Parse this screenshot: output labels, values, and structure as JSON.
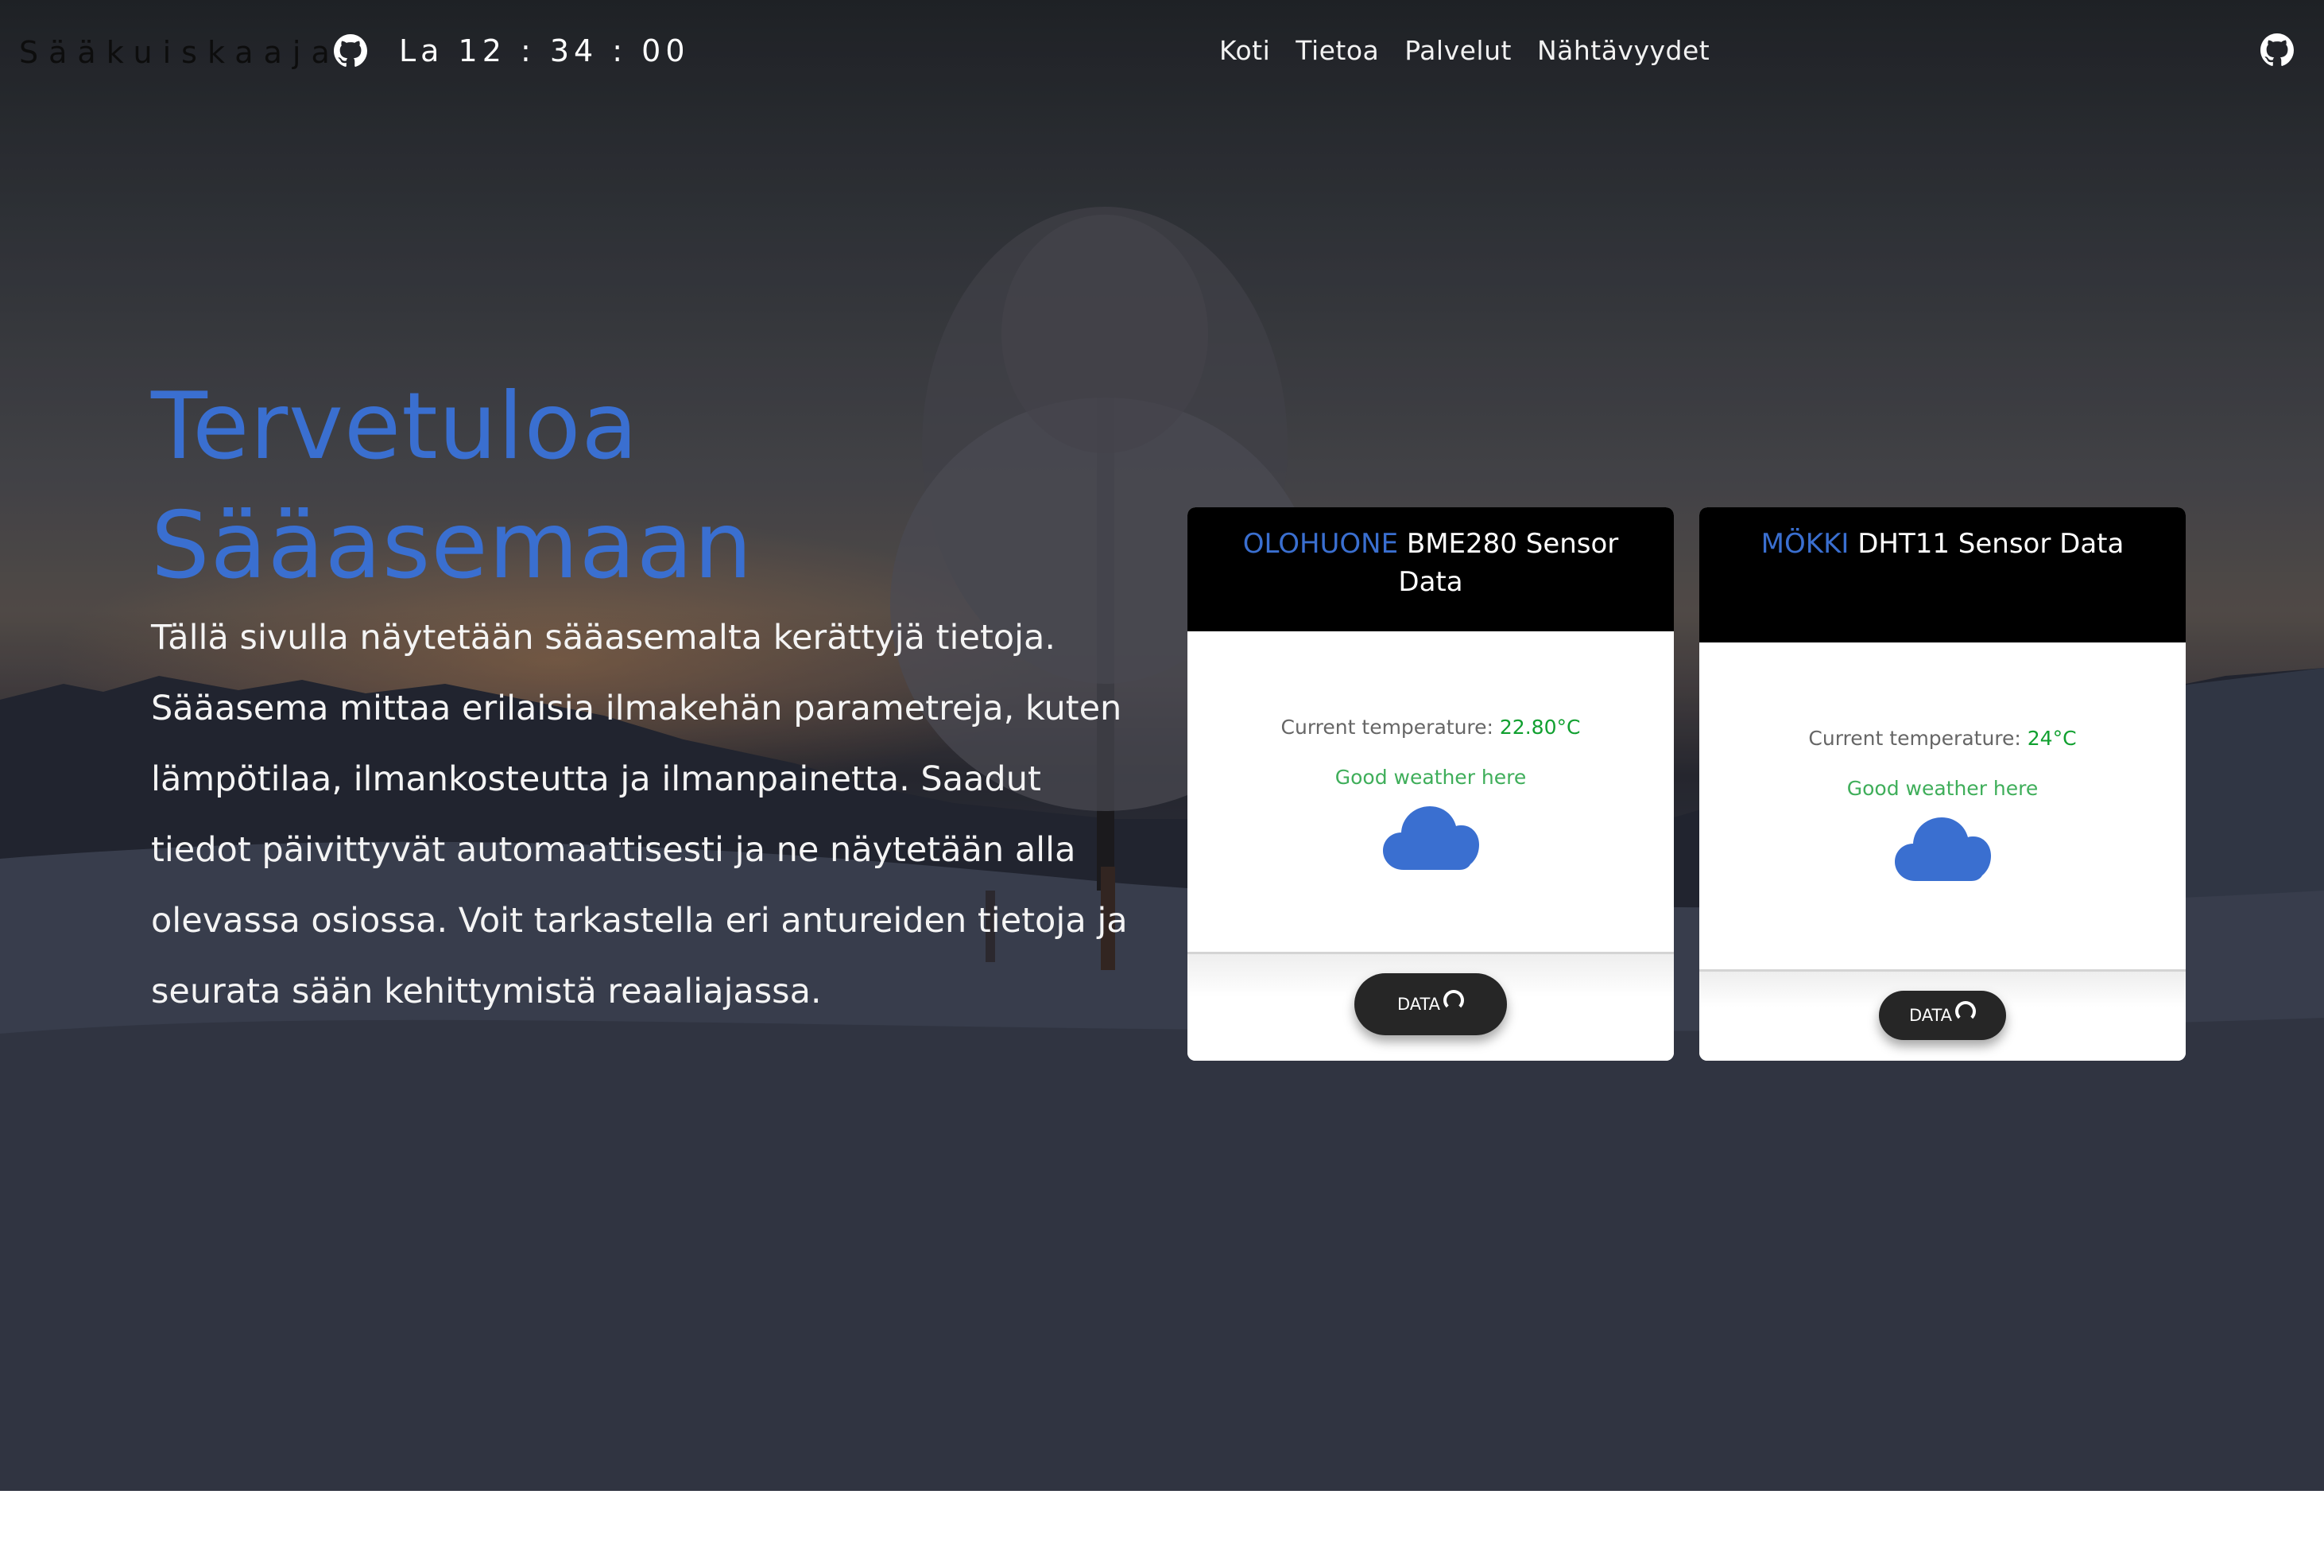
{
  "header": {
    "brand": "Sääkuiskaaja",
    "clock": "La 12 : 34 : 00",
    "nav": [
      "Koti",
      "Tietoa",
      "Palvelut",
      "Nähtävyydet"
    ]
  },
  "hero": {
    "title_line1": "Tervetuloa",
    "title_line2": "Sääasemaan",
    "lead": "Tällä sivulla näytetään sääasemalta kerättyjä tietoja. Sääasema mittaa erilaisia ilmakehän parametreja, kuten lämpötilaa, ilmankosteutta ja ilmanpainetta. Saadut tiedot päivittyvät automaattisesti ja ne näytetään alla olevassa osiossa. Voit tarkastella eri antureiden tietoja ja seurata sään kehittymistä reaaliajassa."
  },
  "cards": [
    {
      "location": "OLOHUONE",
      "title_rest": " BME280 Sensor Data",
      "temp_label": "Current temperature: ",
      "temp_value": "22.80°C",
      "status": "Good weather here",
      "button_label": "DATA",
      "icon": "cloud-icon"
    },
    {
      "location": "MÖKKI",
      "title_rest": " DHT11 Sensor Data",
      "temp_label": "Current temperature: ",
      "temp_value": "24°C",
      "status": "Good weather here",
      "button_label": "DATA",
      "icon": "cloud-icon"
    }
  ],
  "colors": {
    "accent": "#3a6fd0",
    "temp_value": "#11a030",
    "status_text": "#3fae5a",
    "button_bg": "#262626"
  }
}
